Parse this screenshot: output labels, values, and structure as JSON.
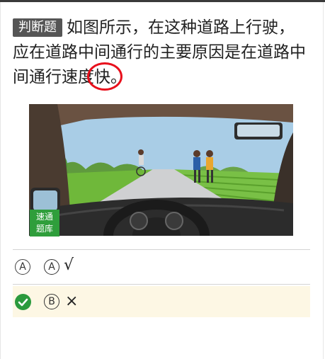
{
  "question": {
    "type_tag": "判断题",
    "text_before": "如图所示，在这种道路上行驶，应在道路中间通行的主要原因是在道路中间通行速度",
    "highlighted": "快",
    "text_after": "。"
  },
  "image": {
    "watermark_line1": "速通",
    "watermark_line2": "题库"
  },
  "options": [
    {
      "marker": "A",
      "label": "A",
      "text": "√",
      "selected": false
    },
    {
      "marker": "check",
      "label": "B",
      "text": "×",
      "selected": true,
      "correct": true
    }
  ],
  "colors": {
    "tag_bg": "#555555",
    "highlight_ring": "#e8101c",
    "correct_green": "#2b9a3d",
    "selected_bg": "#fdf7e4"
  }
}
